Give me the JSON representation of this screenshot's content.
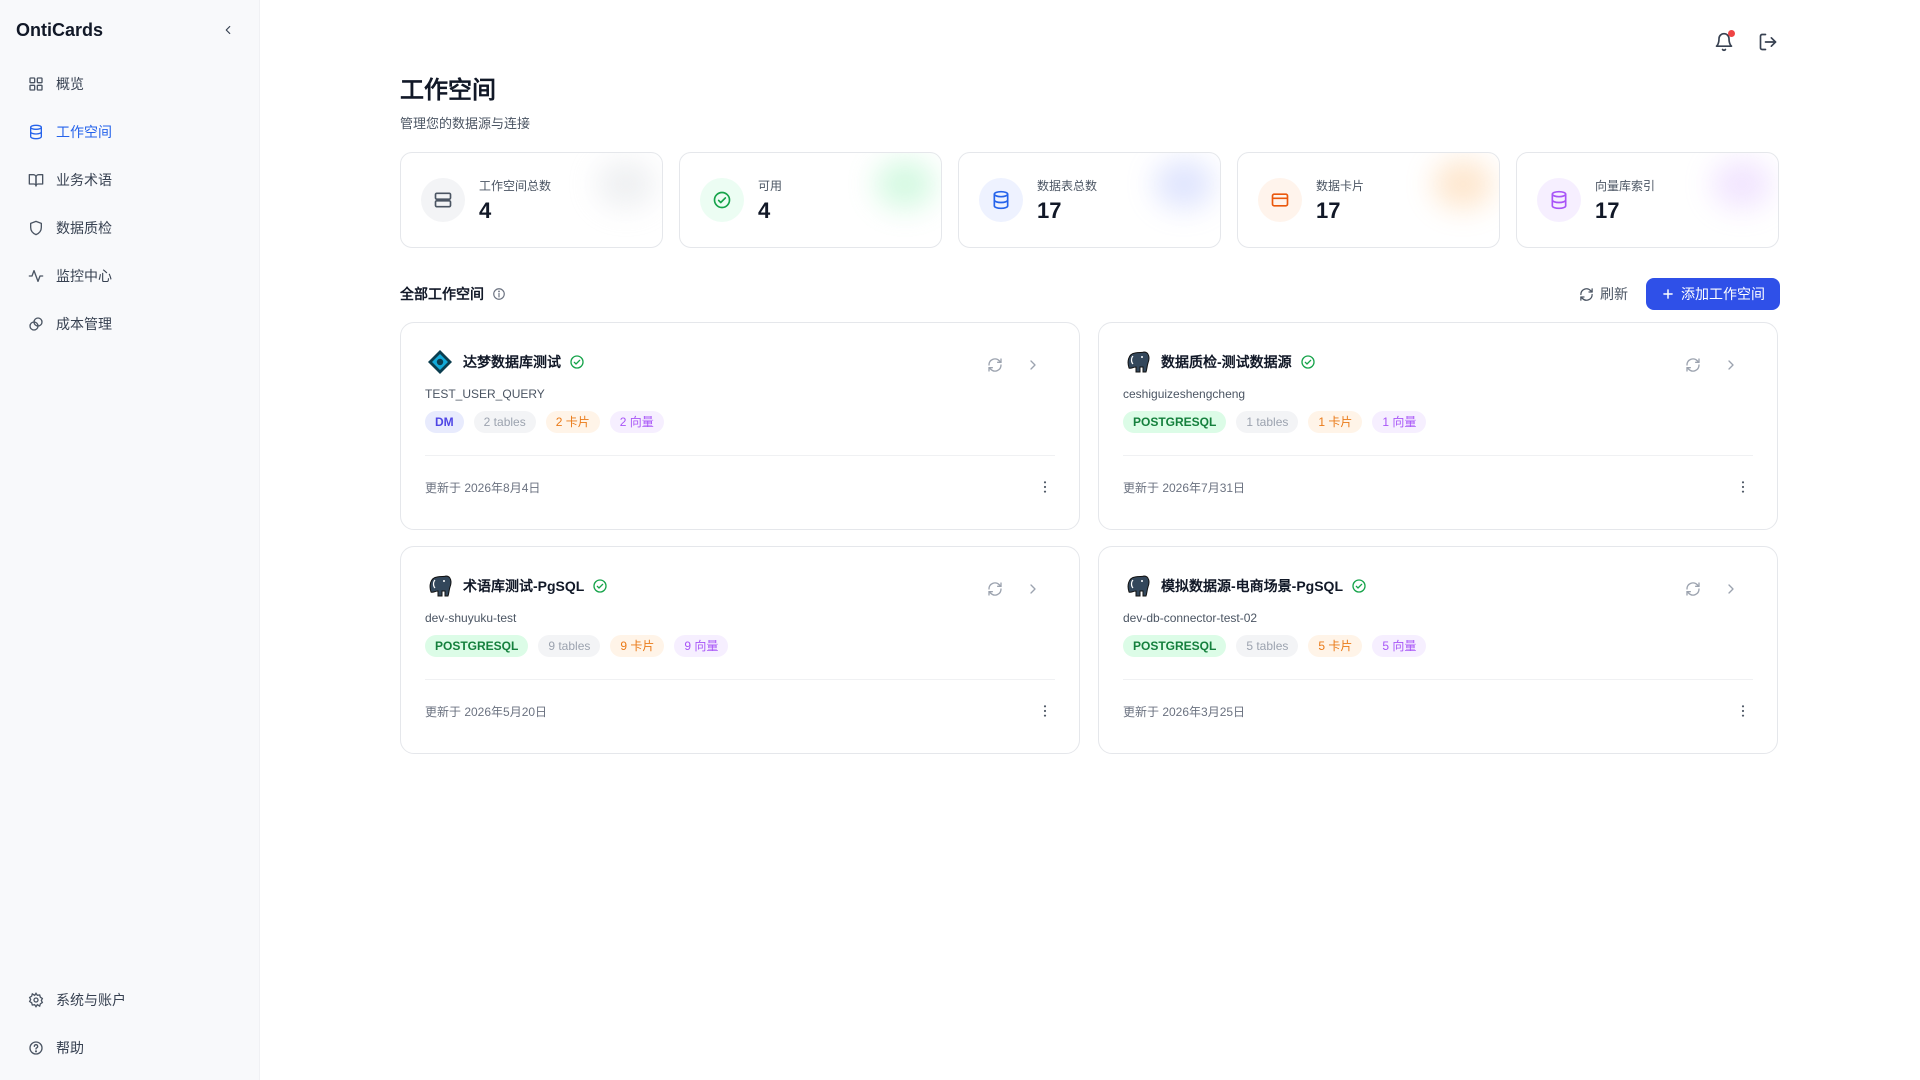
{
  "app": {
    "brand": "OntiCards"
  },
  "sidebar": {
    "items": [
      {
        "label": "概览",
        "icon": "grid-icon",
        "active": false
      },
      {
        "label": "工作空间",
        "icon": "database-icon",
        "active": true
      },
      {
        "label": "业务术语",
        "icon": "book-icon",
        "active": false
      },
      {
        "label": "数据质检",
        "icon": "shield-icon",
        "active": false
      },
      {
        "label": "监控中心",
        "icon": "activity-icon",
        "active": false
      },
      {
        "label": "成本管理",
        "icon": "coins-icon",
        "active": false
      }
    ],
    "bottom": [
      {
        "label": "系统与账户",
        "icon": "gear-icon"
      },
      {
        "label": "帮助",
        "icon": "help-icon"
      }
    ]
  },
  "page": {
    "title": "工作空间",
    "subtitle": "管理您的数据源与连接"
  },
  "stats": [
    {
      "label": "工作空间总数",
      "value": "4",
      "icon": "server-icon",
      "color": "#6b7280",
      "bg": "#f3f4f6",
      "glow": "#e5e7eb"
    },
    {
      "label": "可用",
      "value": "4",
      "icon": "check-circle-icon",
      "color": "#16a34a",
      "bg": "#ecfdf3",
      "glow": "#bbf7d0"
    },
    {
      "label": "数据表总数",
      "value": "17",
      "icon": "database-icon",
      "color": "#2563eb",
      "bg": "#eef2ff",
      "glow": "#c7d2fe"
    },
    {
      "label": "数据卡片",
      "value": "17",
      "icon": "card-icon",
      "color": "#ea580c",
      "bg": "#fff4ec",
      "glow": "#fed7aa"
    },
    {
      "label": "向量库索引",
      "value": "17",
      "icon": "database-icon",
      "color": "#a855f7",
      "bg": "#f6efff",
      "glow": "#e9d5ff"
    }
  ],
  "section": {
    "title": "全部工作空间",
    "refresh_label": "刷新",
    "add_label": "添加工作空间"
  },
  "workspaces": [
    {
      "name": "达梦数据库测试",
      "code": "TEST_USER_QUERY",
      "engine": "DM",
      "engine_color": "#4f46e5",
      "engine_bg": "#e8ebfd",
      "logo": "dameng-logo-icon",
      "tables": "2 tables",
      "cards": "2 卡片",
      "vectors": "2 向量",
      "updated": "更新于 2026年8月4日"
    },
    {
      "name": "数据质检-测试数据源",
      "code": "ceshiguizeshengcheng",
      "engine": "POSTGRESQL",
      "engine_color": "#15803d",
      "engine_bg": "#dcfce7",
      "logo": "postgresql-elephant-icon",
      "tables": "1 tables",
      "cards": "1 卡片",
      "vectors": "1 向量",
      "updated": "更新于 2026年7月31日"
    },
    {
      "name": "术语库测试-PgSQL",
      "code": "dev-shuyuku-test",
      "engine": "POSTGRESQL",
      "engine_color": "#15803d",
      "engine_bg": "#dcfce7",
      "logo": "postgresql-elephant-icon",
      "tables": "9 tables",
      "cards": "9 卡片",
      "vectors": "9 向量",
      "updated": "更新于 2026年5月20日"
    },
    {
      "name": "模拟数据源-电商场景-PgSQL",
      "code": "dev-db-connector-test-02",
      "engine": "POSTGRESQL",
      "engine_color": "#15803d",
      "engine_bg": "#dcfce7",
      "logo": "postgresql-elephant-icon",
      "tables": "5 tables",
      "cards": "5 卡片",
      "vectors": "5 向量",
      "updated": "更新于 2026年3月25日"
    }
  ]
}
